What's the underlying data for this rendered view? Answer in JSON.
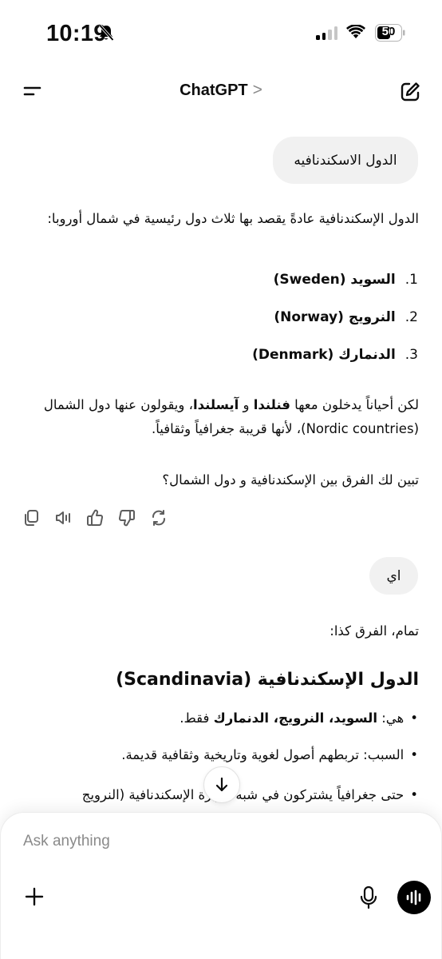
{
  "status_bar": {
    "time": "10:19",
    "battery": "50"
  },
  "nav": {
    "title": "ChatGPT",
    "chevron": ">"
  },
  "chat": {
    "user_message_1": "الدول الاسكندنافيه",
    "assistant_1": {
      "intro": "الدول الإسكندنافية عادةً يقصد بها ثلاث دول رئيسية في شمال أوروبا:",
      "list": [
        {
          "num": "1.",
          "text": "السويد (Sweden)"
        },
        {
          "num": "2.",
          "text": "النرويج (Norway)"
        },
        {
          "num": "3.",
          "text": "الدنمارك (Denmark)"
        }
      ],
      "note_prefix": "لكن أحياناً يدخلون معها ",
      "note_bold_1": "فنلندا",
      "note_mid": " و ",
      "note_bold_2": "آيسلندا",
      "note_suffix": "، ويقولون عنها دول الشمال (Nordic countries)، لأنها قريبة جغرافياً وثقافياً.",
      "question": "تبين لك الفرق بين الإسكندنافية و دول الشمال؟"
    },
    "user_message_2": "اي",
    "assistant_2": {
      "intro": "تمام، الفرق كذا:",
      "heading": "الدول الإسكندنافية (Scandinavia)",
      "bullet_1_prefix": "هي: ",
      "bullet_1_bold": "السويد، النرويج، الدنمارك",
      "bullet_1_suffix": " فقط.",
      "bullet_2": "السبب: تربطهم أصول لغوية وتاريخية وثقافية قديمة.",
      "bullet_3": "حتى جغرافياً يشتركون في شبه جزيرة الإسكندنافية (النرويج"
    }
  },
  "composer": {
    "placeholder": "Ask anything"
  },
  "icons": [
    "menu-icon",
    "compose-icon",
    "copy-icon",
    "speaker-icon",
    "thumbs-up-icon",
    "thumbs-down-icon",
    "regenerate-icon",
    "arrow-down-icon",
    "plus-icon",
    "mic-icon",
    "voice-mode-icon"
  ]
}
